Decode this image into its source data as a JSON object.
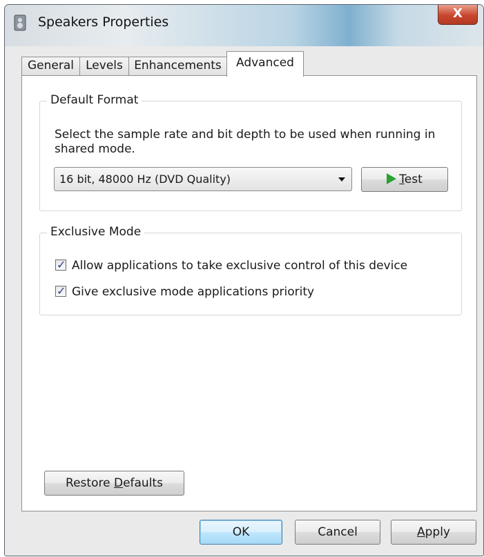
{
  "window": {
    "title": "Speakers Properties",
    "close_label": "X"
  },
  "tabs": [
    {
      "label": "General",
      "active": false
    },
    {
      "label": "Levels",
      "active": false
    },
    {
      "label": "Enhancements",
      "active": false
    },
    {
      "label": "Advanced",
      "active": true
    }
  ],
  "default_format": {
    "legend": "Default Format",
    "description": "Select the sample rate and bit depth to be used when running in shared mode.",
    "selected_format": "16 bit, 48000 Hz (DVD Quality)",
    "test_label_first": "T",
    "test_label_rest": "est"
  },
  "exclusive_mode": {
    "legend": "Exclusive Mode",
    "options": [
      {
        "label": "Allow applications to take exclusive control of this device",
        "checked": true
      },
      {
        "label": "Give exclusive mode applications priority",
        "checked": true
      }
    ]
  },
  "restore": {
    "pre": "Restore ",
    "key": "D",
    "post": "efaults"
  },
  "footer": {
    "ok": "OK",
    "cancel": "Cancel",
    "apply_key": "A",
    "apply_rest": "pply"
  },
  "colors": {
    "play_icon": "#2aa232",
    "close_button": "#c9462e",
    "checkmark": "#2b3c8c"
  }
}
